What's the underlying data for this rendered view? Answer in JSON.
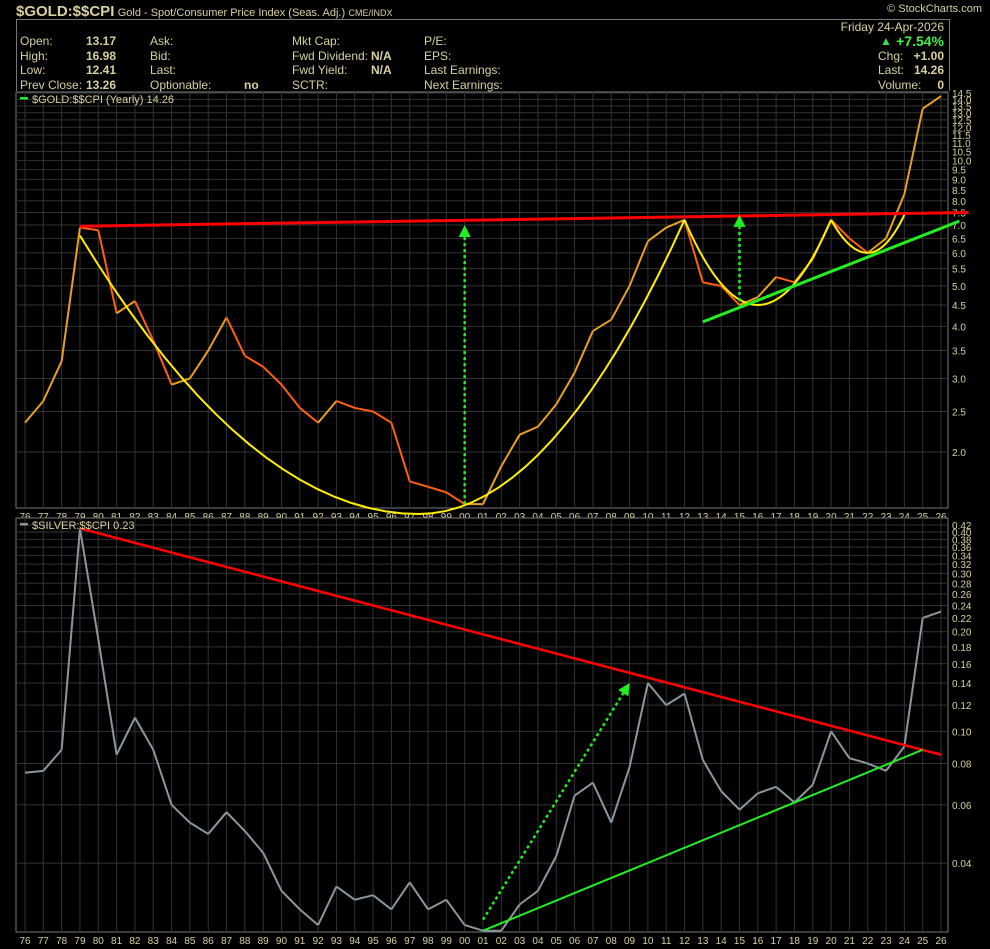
{
  "title": {
    "symbol": "$GOLD:$$CPI",
    "description": "Gold - Spot/Consumer Price Index (Seas. Adj.)",
    "exchange": "CME/INDX"
  },
  "logo": "© StockCharts.com",
  "quote": {
    "open_label": "Open:",
    "open": "13.17",
    "high_label": "High:",
    "high": "16.98",
    "low_label": "Low:",
    "low": "12.41",
    "prev_label": "Prev Close:",
    "prev": "13.26",
    "ask_label": "Ask:",
    "bid_label": "Bid:",
    "last_label": "Last:",
    "optionable_label": "Optionable:",
    "optionable": "no",
    "mktcap_label": "Mkt Cap:",
    "fwddiv_label": "Fwd Dividend:",
    "fwddiv": "N/A",
    "fwdyield_label": "Fwd Yield:",
    "fwdyield": "N/A",
    "sctr_label": "SCTR:",
    "pe_label": "P/E:",
    "eps_label": "EPS:",
    "lastearn_label": "Last Earnings:",
    "nextearn_label": "Next Earnings:",
    "date": "Friday  24-Apr-2026",
    "pct": "+7.54%",
    "chg_label": "Chg:",
    "chg": "+1.00",
    "lastp_label": "Last:",
    "lastp": "14.26",
    "vol_label": "Volume:",
    "vol": "0"
  },
  "colors": {
    "up": "#e8a020",
    "down": "#ff6010",
    "silver": "#8a96a0",
    "red": "#ff0000",
    "green": "#22ee22",
    "yellow": "#ffee00",
    "grid": "#333",
    "text": "#d8d0a0"
  },
  "chart_data": [
    {
      "type": "line",
      "title": "$GOLD:$$CPI (Yearly) 14.26",
      "scale": "log",
      "ylim": [
        1.4,
        14.8
      ],
      "x": [
        "76",
        "77",
        "78",
        "79",
        "80",
        "81",
        "82",
        "83",
        "84",
        "85",
        "86",
        "87",
        "88",
        "89",
        "90",
        "91",
        "92",
        "93",
        "94",
        "95",
        "96",
        "97",
        "98",
        "99",
        "00",
        "01",
        "02",
        "03",
        "04",
        "05",
        "06",
        "07",
        "08",
        "09",
        "10",
        "11",
        "12",
        "13",
        "14",
        "15",
        "16",
        "17",
        "18",
        "19",
        "20",
        "21",
        "22",
        "23",
        "24",
        "25",
        "26"
      ],
      "values": [
        2.35,
        2.65,
        3.3,
        6.9,
        6.8,
        4.3,
        4.6,
        3.7,
        2.9,
        3.0,
        3.5,
        4.2,
        3.4,
        3.2,
        2.9,
        2.55,
        2.35,
        2.65,
        2.55,
        2.5,
        2.35,
        1.7,
        1.65,
        1.6,
        1.5,
        1.5,
        1.85,
        2.2,
        2.3,
        2.6,
        3.1,
        3.9,
        4.15,
        5.0,
        6.4,
        6.9,
        7.2,
        5.1,
        5.0,
        4.5,
        4.7,
        5.25,
        5.1,
        5.8,
        7.2,
        6.5,
        6.0,
        6.5,
        8.3,
        13.3,
        14.26
      ],
      "yticks": [
        "14.5",
        "14.0",
        "13.5",
        "13.0",
        "12.5",
        "12.0",
        "11.5",
        "11.0",
        "10.5",
        "10.0",
        "9.5",
        "9.0",
        "8.5",
        "8.0",
        "7.5",
        "7.0",
        "6.5",
        "6.0",
        "5.5",
        "5.0",
        "4.5",
        "4.0",
        "3.5",
        "3.0",
        "2.5",
        "2.0"
      ],
      "annotations": {
        "resistance": [
          [
            3,
            6.95
          ],
          [
            51.5,
            7.5
          ]
        ],
        "support": [
          [
            37,
            4.1
          ],
          [
            51,
            7.15
          ]
        ],
        "cups": [
          {
            "from": [
              3,
              6.6
            ],
            "low": [
              21.5,
              1.42
            ],
            "to": [
              36,
              7.2
            ]
          },
          {
            "from": [
              36,
              7.2
            ],
            "low": [
              40,
              4.5
            ],
            "to": [
              44,
              7.2
            ]
          },
          {
            "from": [
              44,
              7.2
            ],
            "low": [
              46,
              6.0
            ],
            "to": [
              48,
              7.4
            ]
          }
        ],
        "arrows": [
          [
            [
              24,
              1.5
            ],
            [
              24,
              7.0
            ]
          ],
          [
            [
              39,
              4.6
            ],
            [
              39,
              7.4
            ]
          ]
        ]
      }
    },
    {
      "type": "line",
      "title": "$SILVER:$$CPI 0.23",
      "scale": "log",
      "ylim": [
        0.024,
        0.43
      ],
      "values": [
        0.075,
        0.076,
        0.088,
        0.41,
        0.19,
        0.085,
        0.11,
        0.088,
        0.06,
        0.053,
        0.049,
        0.057,
        0.05,
        0.043,
        0.033,
        0.029,
        0.026,
        0.034,
        0.031,
        0.032,
        0.029,
        0.035,
        0.029,
        0.031,
        0.026,
        0.025,
        0.025,
        0.03,
        0.033,
        0.042,
        0.064,
        0.07,
        0.053,
        0.078,
        0.14,
        0.12,
        0.13,
        0.082,
        0.066,
        0.058,
        0.065,
        0.068,
        0.061,
        0.069,
        0.1,
        0.083,
        0.08,
        0.076,
        0.09,
        0.22,
        0.23
      ],
      "yticks": [
        "0.42",
        "0.40",
        "0.38",
        "0.36",
        "0.34",
        "0.32",
        "0.30",
        "0.28",
        "0.26",
        "0.24",
        "0.22",
        "0.20",
        "0.18",
        "0.16",
        "0.14",
        "0.12",
        "0.10",
        "0.08",
        "0.06",
        "0.04"
      ],
      "annotations": {
        "resistance": [
          [
            3,
            0.41
          ],
          [
            50,
            0.085
          ]
        ],
        "support": [
          [
            25,
            0.025
          ],
          [
            49,
            0.088
          ]
        ],
        "arrows": [
          [
            [
              25,
              0.027
            ],
            [
              33,
              0.14
            ]
          ]
        ]
      }
    }
  ]
}
